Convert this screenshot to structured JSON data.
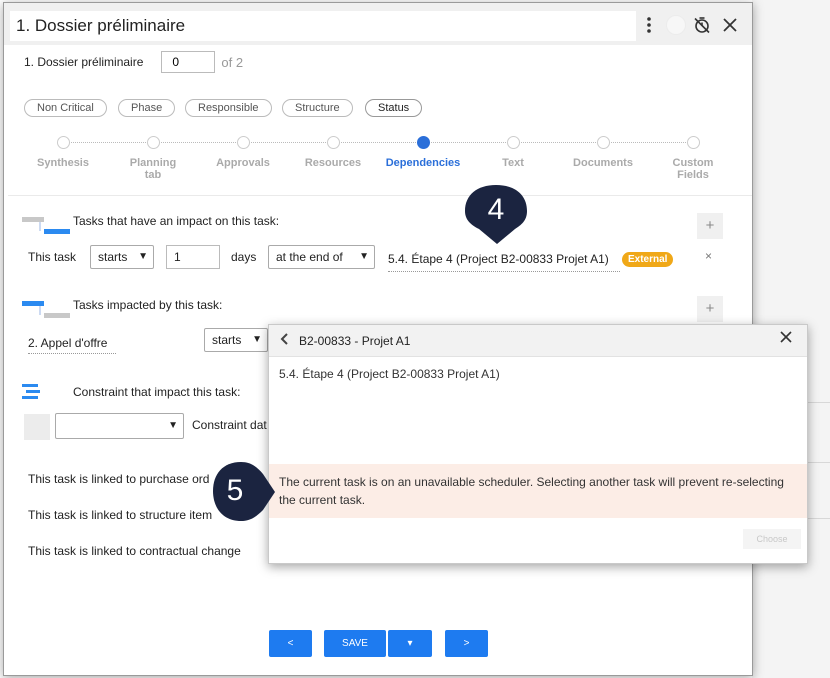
{
  "modal": {
    "title": "1. Dossier préliminaire",
    "dossier_label": "1. Dossier préliminaire",
    "dossier_value": "0",
    "of_text": "of 2"
  },
  "chips": [
    "Non Critical",
    "Phase",
    "Responsible",
    "Structure",
    "Status"
  ],
  "steps": [
    {
      "label": "Synthesis"
    },
    {
      "label": "Planning tab"
    },
    {
      "label": "Approvals"
    },
    {
      "label": "Resources"
    },
    {
      "label": "Dependencies",
      "active": true
    },
    {
      "label": "Text"
    },
    {
      "label": "Documents"
    },
    {
      "label": "Custom Fields"
    }
  ],
  "impact_section": {
    "title": "Tasks that have an impact on this task:",
    "this_task": "This task",
    "starts": "starts",
    "days_value": "1",
    "days": "days",
    "at_the_end_of": "at the end of",
    "task_ref": "5.4. Étape 4 (Project B2-00833 Projet A1)",
    "badge": "External",
    "remove": "×",
    "plus": "+"
  },
  "impacted_section": {
    "title": "Tasks impacted by this task:",
    "task": "2. Appel d'offre",
    "starts": "starts",
    "plus": "+"
  },
  "constraint_section": {
    "title": "Constraint that impact this task:",
    "constraint_label": "Constraint dat"
  },
  "links": {
    "purchase": "This task is linked to purchase ord",
    "structure": "This task is linked to structure item",
    "contractual": "This task is linked to contractual change"
  },
  "footer": {
    "prev": "<",
    "save": "SAVE",
    "dropdown": "▾",
    "next": ">"
  },
  "popup": {
    "title": "B2-00833 - Projet A1",
    "item": "5.4. Étape 4 (Project B2-00833 Projet A1)",
    "warning": "The current task is on an unavailable scheduler. Selecting another task will prevent re-selecting the current task.",
    "choose": "Choose"
  },
  "callouts": {
    "four": "4",
    "five": "5"
  },
  "colors": {
    "accent": "#2b6fd9",
    "button": "#1e7bf0",
    "badge": "#f0a818",
    "callout": "#1b2440",
    "warning_bg": "#fcede6"
  }
}
